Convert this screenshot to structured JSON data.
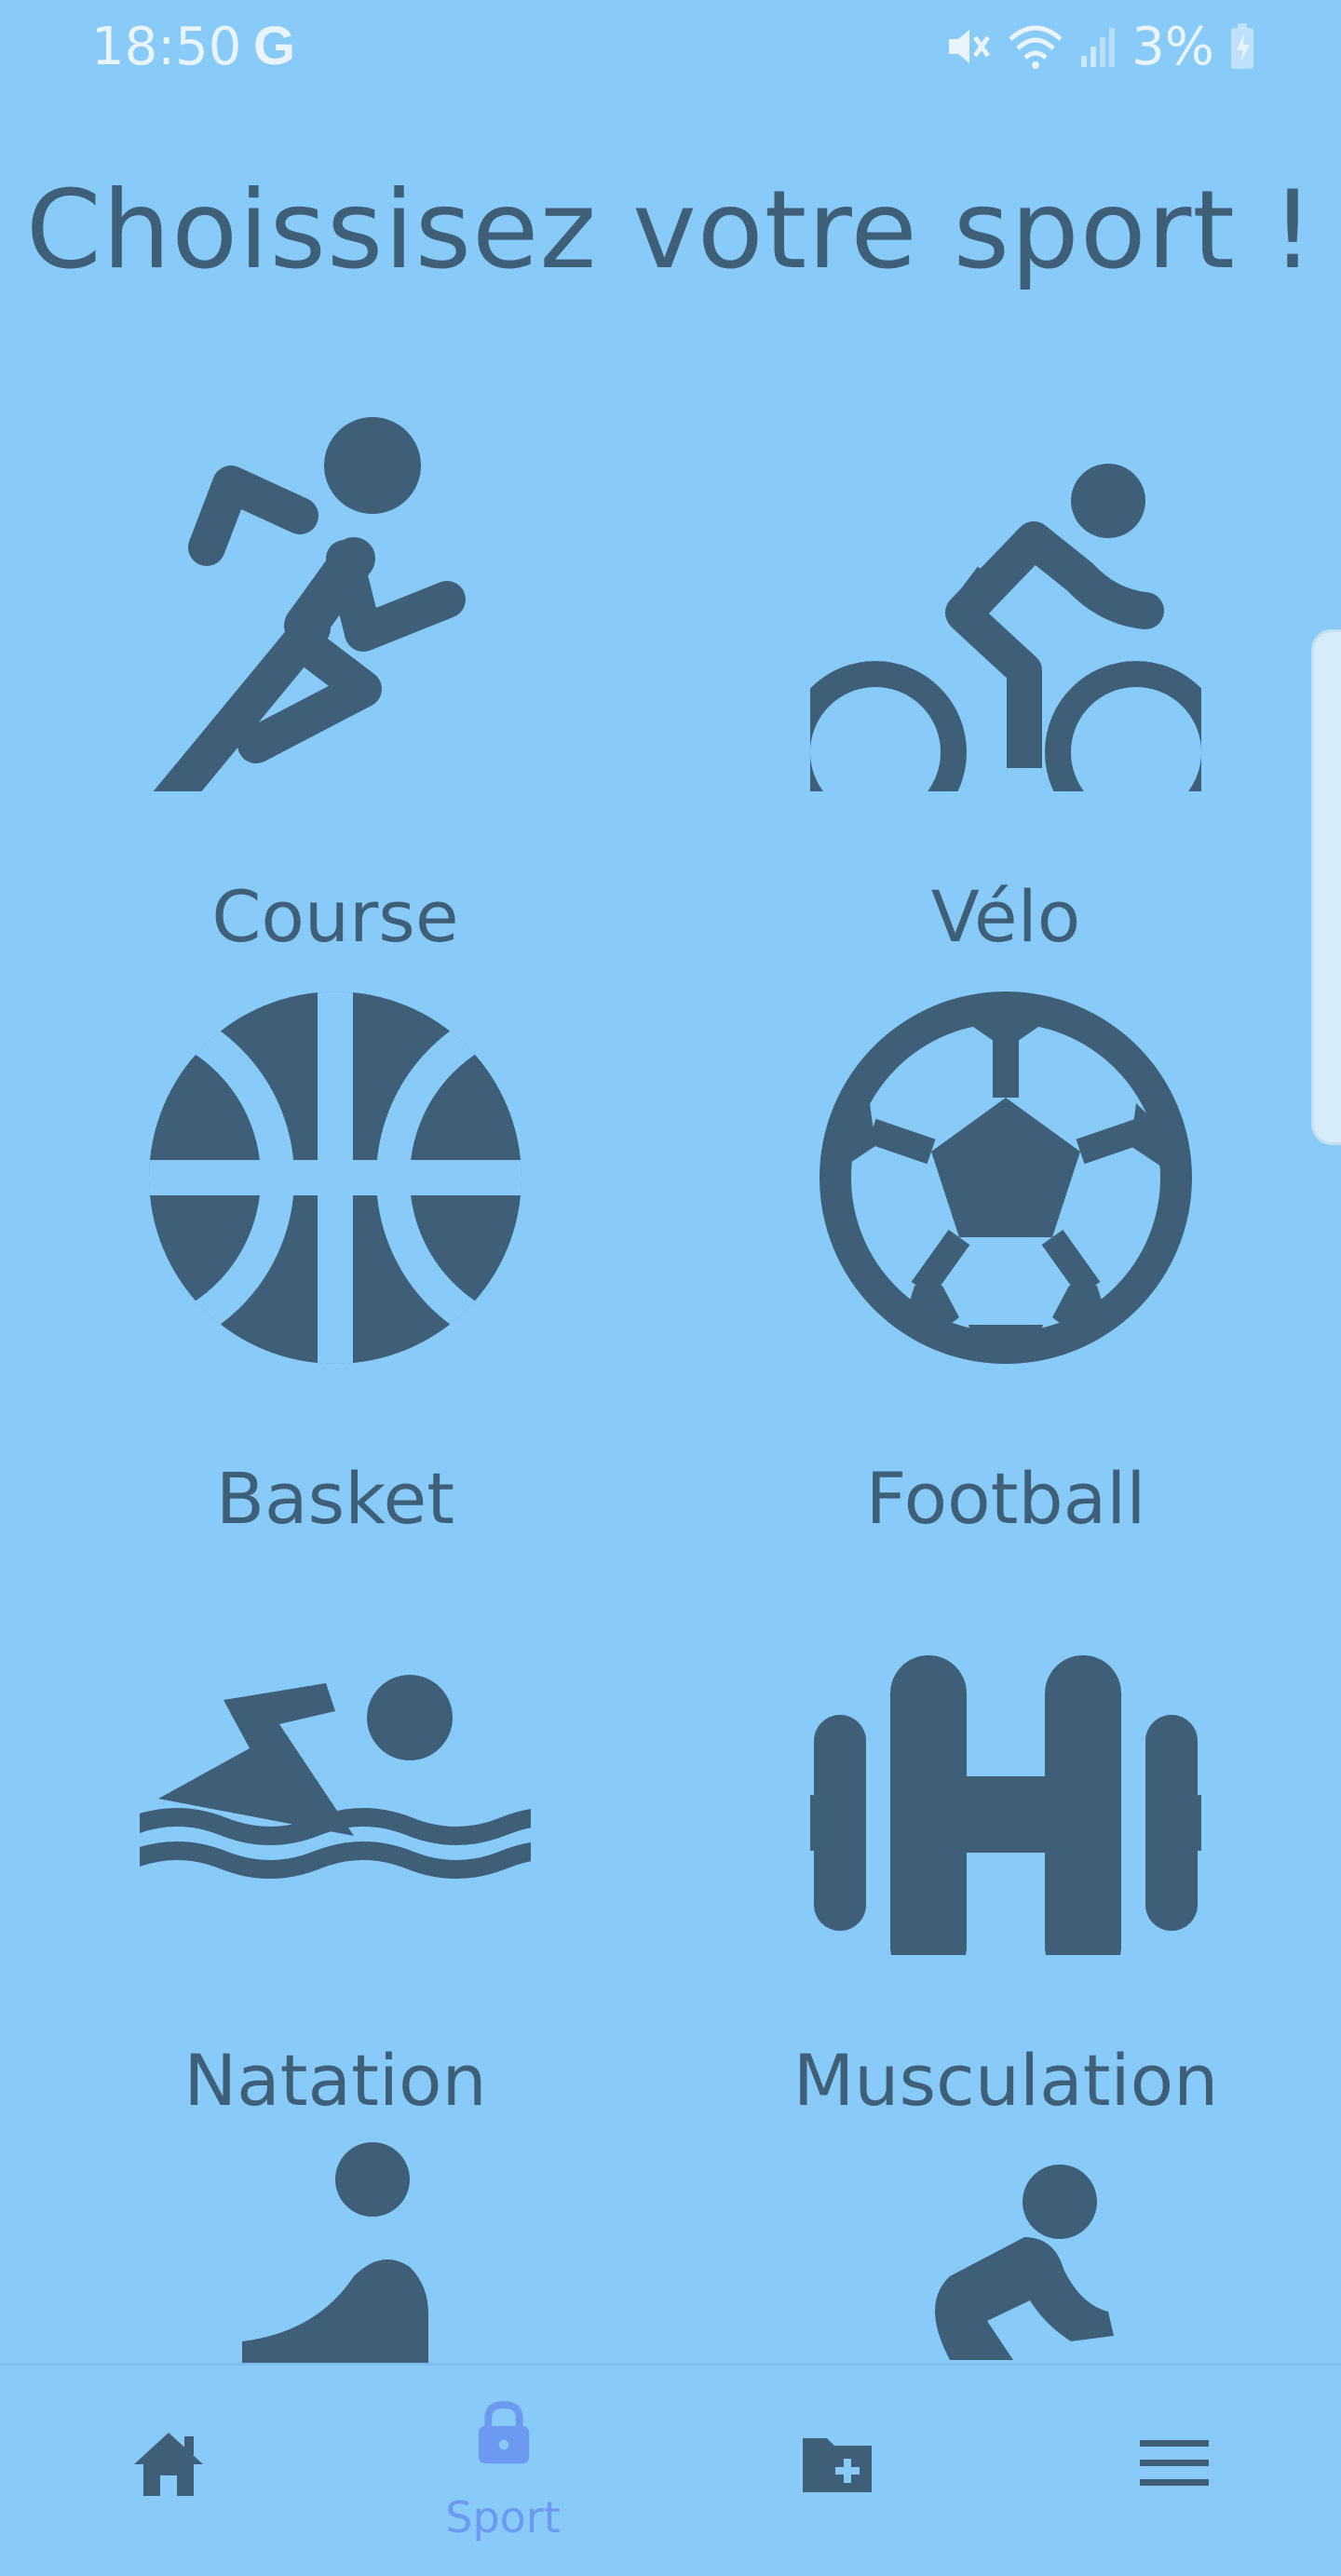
{
  "status_bar": {
    "time": "18:50",
    "google_badge": "G",
    "battery_percent": "3%",
    "icons": [
      "mute-icon",
      "wifi-icon",
      "signal-icon",
      "battery-charging-icon"
    ]
  },
  "page": {
    "title": "Choissisez votre sport !"
  },
  "sports": [
    {
      "label": "Course",
      "icon": "running-icon"
    },
    {
      "label": "Vélo",
      "icon": "cycling-icon"
    },
    {
      "label": "Basket",
      "icon": "basketball-icon"
    },
    {
      "label": "Football",
      "icon": "soccer-ball-icon"
    },
    {
      "label": "Natation",
      "icon": "swimming-icon"
    },
    {
      "label": "Musculation",
      "icon": "dumbbell-icon"
    },
    {
      "label": "",
      "icon": "yoga-icon"
    },
    {
      "label": "",
      "icon": "stretching-icon"
    }
  ],
  "bottom_nav": {
    "items": [
      {
        "label": "",
        "icon": "home-icon",
        "active": false
      },
      {
        "label": "Sport",
        "icon": "lock-icon",
        "active": true
      },
      {
        "label": "",
        "icon": "folder-add-icon",
        "active": false
      },
      {
        "label": "",
        "icon": "menu-icon",
        "active": false
      }
    ]
  },
  "colors": {
    "background": "#89CBF8",
    "icon": "#3E5F77",
    "active_nav": "#6C9AF0",
    "status_text": "#EAF4FD"
  }
}
